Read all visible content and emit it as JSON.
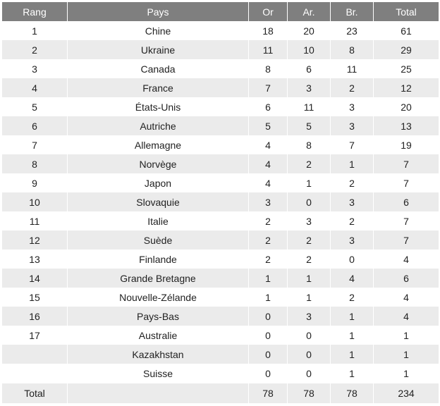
{
  "table": {
    "headers": {
      "rang": "Rang",
      "pays": "Pays",
      "or": "Or",
      "ar": "Ar.",
      "br": "Br.",
      "total": "Total"
    },
    "rows": [
      {
        "rang": "1",
        "pays": "Chine",
        "or": "18",
        "ar": "20",
        "br": "23",
        "total": "61"
      },
      {
        "rang": "2",
        "pays": "Ukraine",
        "or": "11",
        "ar": "10",
        "br": "8",
        "total": "29"
      },
      {
        "rang": "3",
        "pays": "Canada",
        "or": "8",
        "ar": "6",
        "br": "11",
        "total": "25"
      },
      {
        "rang": "4",
        "pays": "France",
        "or": "7",
        "ar": "3",
        "br": "2",
        "total": "12"
      },
      {
        "rang": "5",
        "pays": "États-Unis",
        "or": "6",
        "ar": "11",
        "br": "3",
        "total": "20"
      },
      {
        "rang": "6",
        "pays": "Autriche",
        "or": "5",
        "ar": "5",
        "br": "3",
        "total": "13"
      },
      {
        "rang": "7",
        "pays": "Allemagne",
        "or": "4",
        "ar": "8",
        "br": "7",
        "total": "19"
      },
      {
        "rang": "8",
        "pays": "Norvège",
        "or": "4",
        "ar": "2",
        "br": "1",
        "total": "7"
      },
      {
        "rang": "9",
        "pays": "Japon",
        "or": "4",
        "ar": "1",
        "br": "2",
        "total": "7"
      },
      {
        "rang": "10",
        "pays": "Slovaquie",
        "or": "3",
        "ar": "0",
        "br": "3",
        "total": "6"
      },
      {
        "rang": "11",
        "pays": "Italie",
        "or": "2",
        "ar": "3",
        "br": "2",
        "total": "7"
      },
      {
        "rang": "12",
        "pays": "Suède",
        "or": "2",
        "ar": "2",
        "br": "3",
        "total": "7"
      },
      {
        "rang": "13",
        "pays": "Finlande",
        "or": "2",
        "ar": "2",
        "br": "0",
        "total": "4"
      },
      {
        "rang": "14",
        "pays": "Grande Bretagne",
        "or": "1",
        "ar": "1",
        "br": "4",
        "total": "6"
      },
      {
        "rang": "15",
        "pays": "Nouvelle-Zélande",
        "or": "1",
        "ar": "1",
        "br": "2",
        "total": "4"
      },
      {
        "rang": "16",
        "pays": "Pays-Bas",
        "or": "0",
        "ar": "3",
        "br": "1",
        "total": "4"
      },
      {
        "rang": "17",
        "pays": "Australie",
        "or": "0",
        "ar": "0",
        "br": "1",
        "total": "1"
      },
      {
        "rang": "",
        "pays": "Kazakhstan",
        "or": "0",
        "ar": "0",
        "br": "1",
        "total": "1"
      },
      {
        "rang": "",
        "pays": "Suisse",
        "or": "0",
        "ar": "0",
        "br": "1",
        "total": "1"
      }
    ],
    "footer": {
      "rang": "Total",
      "pays": "",
      "or": "78",
      "ar": "78",
      "br": "78",
      "total": "234"
    }
  }
}
